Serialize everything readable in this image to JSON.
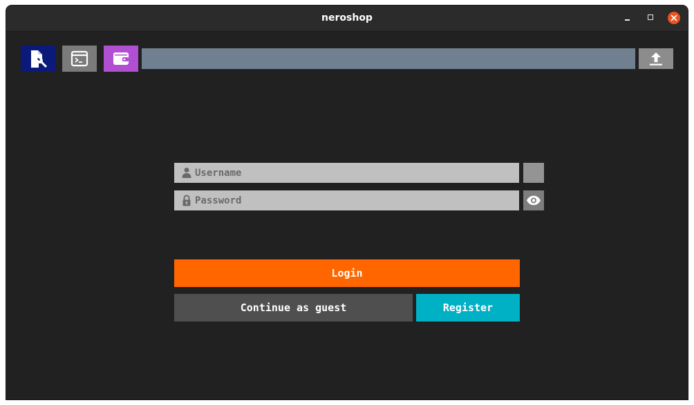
{
  "window": {
    "title": "neroshop"
  },
  "toolbar": {
    "settings_icon": "file-wrench-icon",
    "console_icon": "terminal-icon",
    "wallet_icon": "wallet-icon",
    "upload_icon": "upload-icon",
    "colors": {
      "settings": "#0b1a7a",
      "console": "#7b7b7b",
      "wallet": "#b04fd2",
      "sync_bar": "#708090",
      "upload": "#8c8c8c"
    }
  },
  "login_form": {
    "username": {
      "value": "",
      "placeholder": "Username",
      "icon": "user-icon"
    },
    "password": {
      "value": "",
      "placeholder": "Password",
      "icon": "lock-icon",
      "toggle_icon": "eye-icon"
    },
    "login_label": "Login",
    "guest_label": "Continue as guest",
    "register_label": "Register",
    "colors": {
      "login": "#ff6600",
      "guest": "#4f4f4f",
      "register": "#00b0c4"
    }
  }
}
